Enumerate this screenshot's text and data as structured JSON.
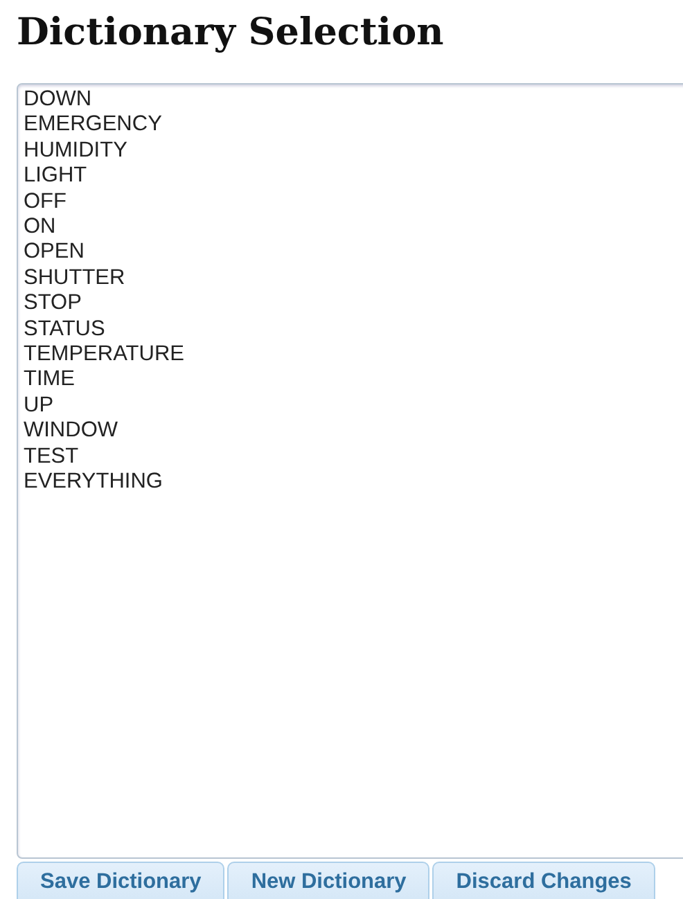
{
  "title": "Dictionary Selection",
  "editor": {
    "lines": [
      "DOWN",
      "EMERGENCY",
      "HUMIDITY",
      "LIGHT",
      "OFF",
      "ON",
      "OPEN",
      "SHUTTER",
      "STOP",
      "STATUS",
      "TEMPERATURE",
      "TIME",
      "UP",
      "WINDOW",
      "TEST",
      "EVERYTHING"
    ]
  },
  "buttons": [
    "Save Dictionary",
    "New Dictionary",
    "Discard Changes"
  ]
}
